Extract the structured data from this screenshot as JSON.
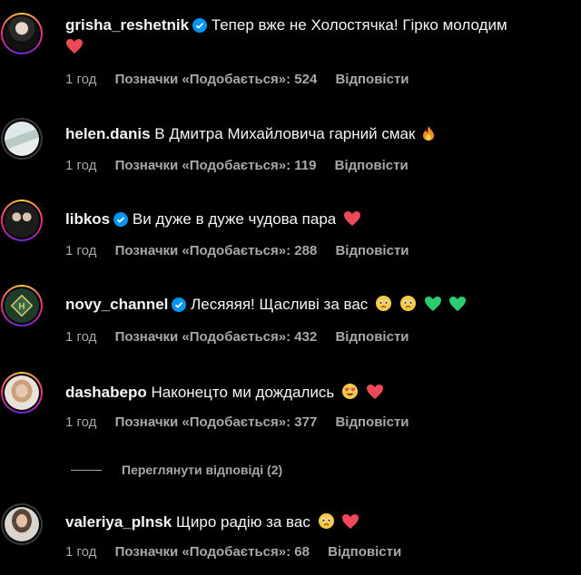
{
  "colors": {
    "background": "#000000",
    "text": "#f5f5f5",
    "meta": "#a8a8a8",
    "verified": "#0095f6",
    "heart": "#ed4956",
    "green_heart": "#2ecc71"
  },
  "labels": {
    "likes_prefix": "Позначки «Подобається»:",
    "reply": "Відповісти"
  },
  "comments": [
    {
      "username": "grisha_reshetnik",
      "verified": true,
      "text": "Тепер вже не Холостячка! Гірко молодим",
      "emoji": [
        "red-heart"
      ],
      "time": "1 год",
      "likes_label": "Позначки «Подобається»: 524",
      "reply": "Відповісти"
    },
    {
      "username": "helen.danis",
      "verified": false,
      "text": "В Дмитра Михайловича гарний смак",
      "emoji": [
        "fire"
      ],
      "time": "1 год",
      "likes_label": "Позначки «Подобається»: 119",
      "reply": "Відповісти"
    },
    {
      "username": "libkos",
      "verified": true,
      "text": "Ви дуже в дуже чудова пара",
      "emoji": [
        "red-heart"
      ],
      "time": "1 год",
      "likes_label": "Позначки «Подобається»: 288",
      "reply": "Відповісти"
    },
    {
      "username": "novy_channel",
      "verified": true,
      "text": "Лесяяяя! Щасливі за вас",
      "emoji": [
        "pleading-face",
        "pleading-face",
        "green-heart",
        "green-heart"
      ],
      "time": "1 год",
      "likes_label": "Позначки «Подобається»: 432",
      "reply": "Відповісти"
    },
    {
      "username": "dashabepo",
      "verified": false,
      "text": "Наконецто ми дождались",
      "emoji": [
        "heart-eyes-face",
        "red-heart"
      ],
      "time": "1 год",
      "likes_label": "Позначки «Подобається»: 377",
      "reply": "Відповісти"
    },
    {
      "username": "valeriya_plnsk",
      "verified": false,
      "text": "Щиро радію за вас",
      "emoji": [
        "pleading-face",
        "red-heart"
      ],
      "time": "1 год",
      "likes_label": "Позначки «Подобається»: 68",
      "reply": "Відповісти"
    }
  ],
  "view_replies": "Переглянути відповіді (2)"
}
